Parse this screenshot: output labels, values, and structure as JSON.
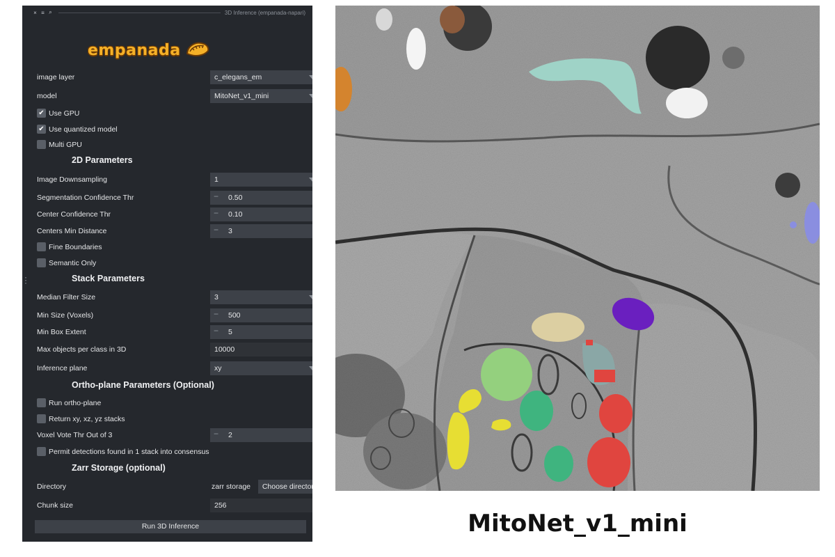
{
  "window": {
    "title": "3D Inference (empanada-napari)",
    "close_glyph": "×",
    "float_glyph": "≡",
    "search_glyph": "⌕"
  },
  "logo": {
    "text": "empanada",
    "icon": "empanada-icon"
  },
  "image_layer": {
    "label": "image layer",
    "value": "c_elegans_em"
  },
  "model": {
    "label": "model",
    "value": "MitoNet_v1_mini"
  },
  "checks": {
    "use_gpu": {
      "label": "Use GPU",
      "checked": true
    },
    "use_quantized": {
      "label": "Use quantized model",
      "checked": true
    },
    "multi_gpu": {
      "label": "Multi GPU",
      "checked": false
    }
  },
  "params_2d": {
    "heading": "2D Parameters",
    "downsampling": {
      "label": "Image Downsampling",
      "value": "1"
    },
    "seg_conf": {
      "label": "Segmentation Confidence Thr",
      "value": "0.50"
    },
    "center_conf": {
      "label": "Center Confidence Thr",
      "value": "0.10"
    },
    "center_min_dist": {
      "label": "Centers Min Distance",
      "value": "3"
    },
    "fine_boundaries": {
      "label": "Fine Boundaries",
      "checked": false
    },
    "semantic_only": {
      "label": "Semantic Only",
      "checked": false
    }
  },
  "stack": {
    "heading": "Stack Parameters",
    "median_filter": {
      "label": "Median Filter Size",
      "value": "3"
    },
    "min_size": {
      "label": "Min Size (Voxels)",
      "value": "500"
    },
    "min_box": {
      "label": "Min Box Extent",
      "value": "5"
    },
    "max_objects": {
      "label": "Max objects per class in 3D",
      "value": "10000"
    },
    "inference_plane": {
      "label": "Inference plane",
      "value": "xy"
    }
  },
  "ortho": {
    "heading": "Ortho-plane Parameters (Optional)",
    "run_ortho": {
      "label": "Run ortho-plane",
      "checked": false
    },
    "return_stacks": {
      "label": "Return xy, xz, yz stacks",
      "checked": false
    },
    "vote_thr": {
      "label": "Voxel Vote Thr Out of 3",
      "value": "2"
    },
    "permit": {
      "label": "Permit detections found in 1 stack into consensus",
      "checked": false
    }
  },
  "zarr": {
    "heading": "Zarr Storage (optional)",
    "directory": {
      "label": "Directory",
      "value": "zarr storage",
      "button": "Choose directory"
    },
    "chunk": {
      "label": "Chunk size",
      "value": "256"
    }
  },
  "spin": {
    "minus": "−",
    "plus": "+"
  },
  "check_glyph": "✔",
  "run_button": "Run 3D Inference",
  "caption": "MitoNet_v1_mini",
  "colors": {
    "panel_bg": "#25282d",
    "control_bg": "#3d4148",
    "logo_orange": "#f5b128",
    "mito_teal": "#9fd3c7",
    "mito_purple": "#6a1fbf",
    "mito_yellow": "#e7de33",
    "mito_green": "#3fb47f",
    "mito_red": "#e0453f"
  }
}
